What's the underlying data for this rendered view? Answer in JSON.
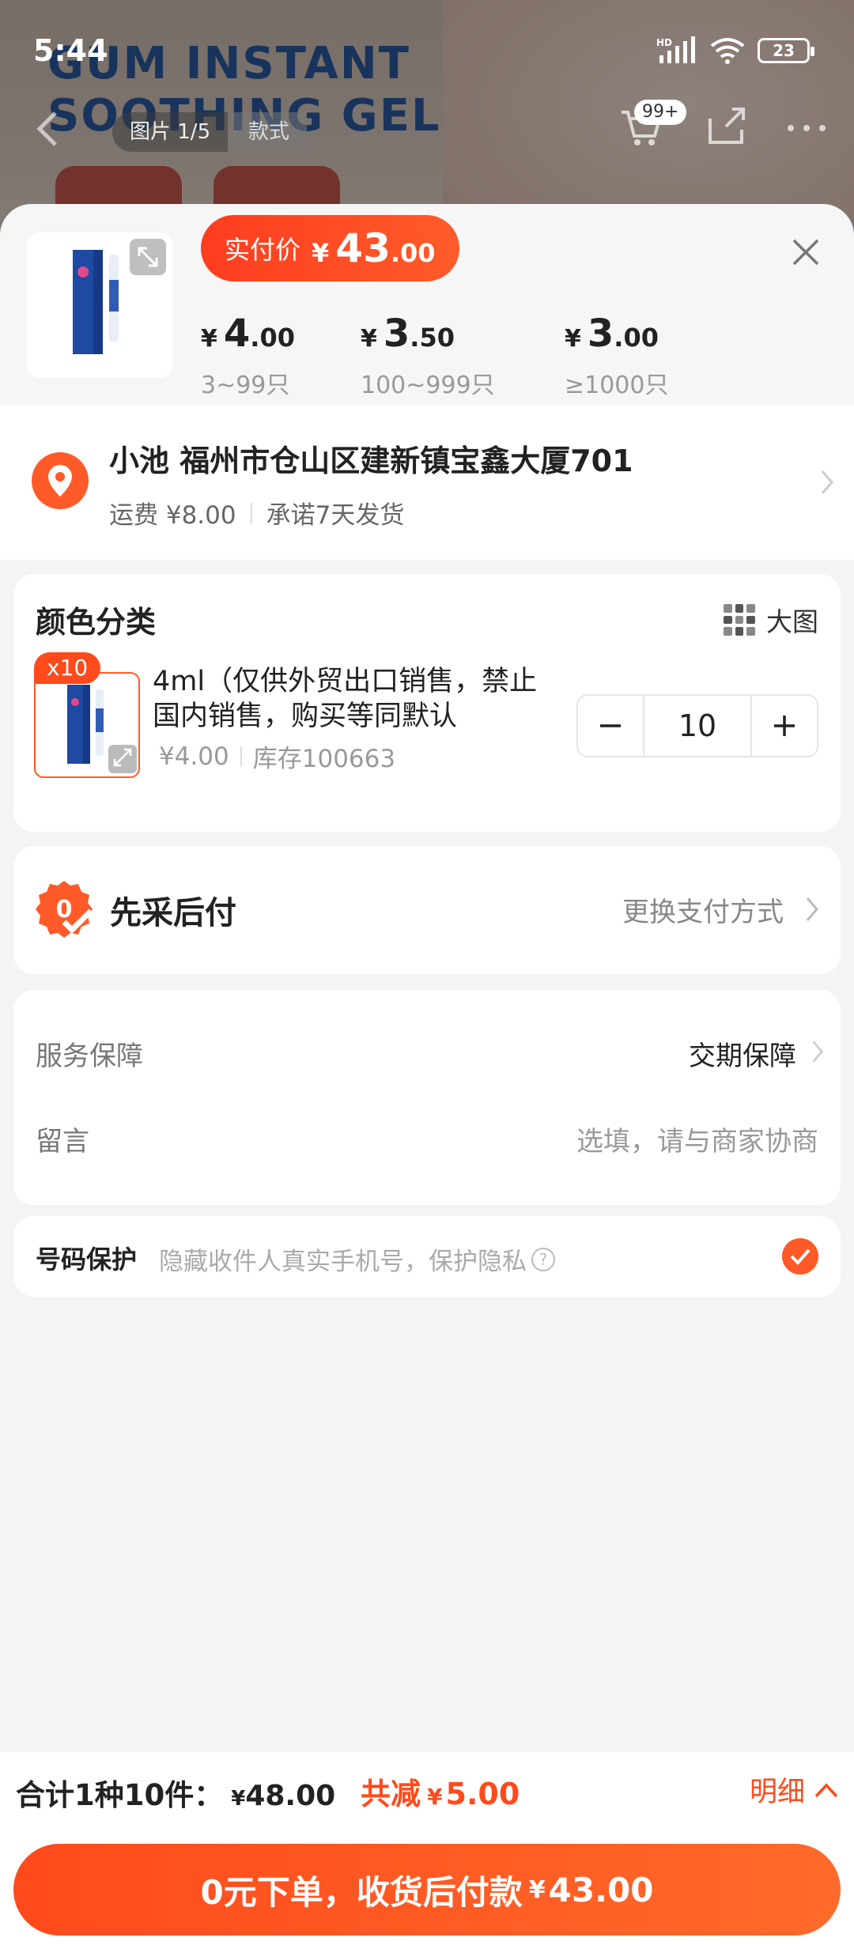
{
  "status_bar": {
    "time": "5:44",
    "battery": "23",
    "network": "HD"
  },
  "background_page": {
    "hero_text_line1": "GUM INSTANT",
    "hero_text_line2": "SOOTHING GEL",
    "image_counter": "图片 1/5",
    "style_tab": "款式",
    "cart_badge": "99+"
  },
  "sheet": {
    "price_pill": {
      "label": "实付价",
      "currency": "¥",
      "integer": "43",
      "decimal": ".00"
    },
    "tiers": [
      {
        "currency": "¥",
        "integer": "4",
        "decimal": ".00",
        "range": "3~99只"
      },
      {
        "currency": "¥",
        "integer": "3",
        "decimal": ".50",
        "range": "100~999只"
      },
      {
        "currency": "¥",
        "integer": "3",
        "decimal": ".00",
        "range": "≥1000只"
      }
    ]
  },
  "address": {
    "line": "小池 福州市仓山区建新镇宝鑫大厦701",
    "shipping": "运费 ¥8.00",
    "promise": "承诺7天发货"
  },
  "color_section": {
    "title": "颜色分类",
    "big_image_label": "大图",
    "sku": {
      "qty_badge": "x10",
      "name": "4ml（仅供外贸出口销售，禁止国内销售，购买等同默认",
      "price": "¥4.00",
      "stock": "库存100663",
      "quantity": "10",
      "minus": "−",
      "plus": "+"
    }
  },
  "payment": {
    "title": "先采后付",
    "change_label": "更换支付方式"
  },
  "service": {
    "guarantee_label": "服务保障",
    "guarantee_value": "交期保障",
    "message_label": "留言",
    "message_placeholder": "选填，请与商家协商"
  },
  "phone_protect": {
    "label": "号码保护",
    "description": "隐藏收件人真实手机号，保护隐私",
    "checked": true
  },
  "bottom_bar": {
    "total_label": "合计1种10件：",
    "total_currency": "¥",
    "total_amount": "48.00",
    "discount_label": "共减",
    "discount_currency": "¥",
    "discount_amount": "5.00",
    "detail_label": "明细",
    "submit_label": "0元下单，收货后付款",
    "submit_currency": "¥",
    "submit_amount": "43.00"
  },
  "colors": {
    "accent": "#ff4a1c",
    "accent_light": "#ff6a2a",
    "background": "#f4f4f4"
  }
}
